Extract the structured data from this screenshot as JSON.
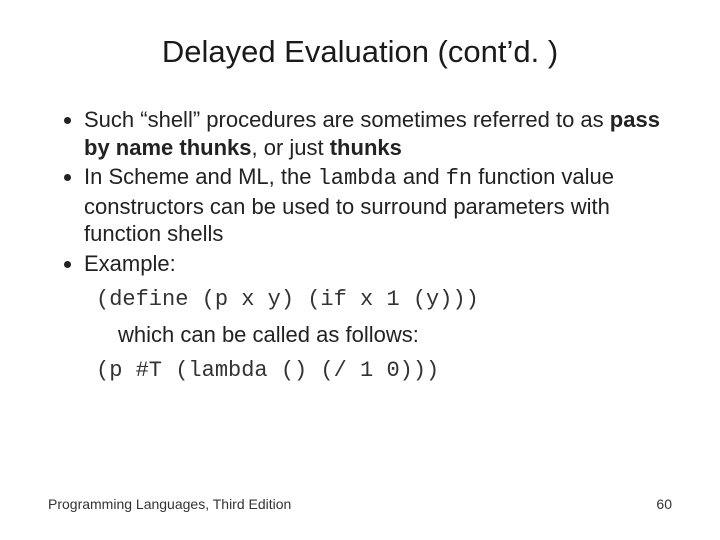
{
  "title": "Delayed Evaluation (cont’d. )",
  "bullets": {
    "b1_pre": "Such “shell” procedures are sometimes referred to as ",
    "b1_bold1": "pass by name thunks",
    "b1_mid": ", or just ",
    "b1_bold2": "thunks",
    "b2_pre": "In Scheme and ML, the ",
    "b2_code1": "lambda",
    "b2_mid1": " and ",
    "b2_code2": "fn",
    "b2_post": " function value constructors can be used to surround parameters with function shells",
    "b3": "Example:"
  },
  "code1": "(define (p x y) (if x 1 (y)))",
  "followup": "which can be called as follows:",
  "code2": "(p #T (lambda () (/ 1 0)))",
  "footer_left": "Programming Languages, Third Edition",
  "footer_right": "60"
}
